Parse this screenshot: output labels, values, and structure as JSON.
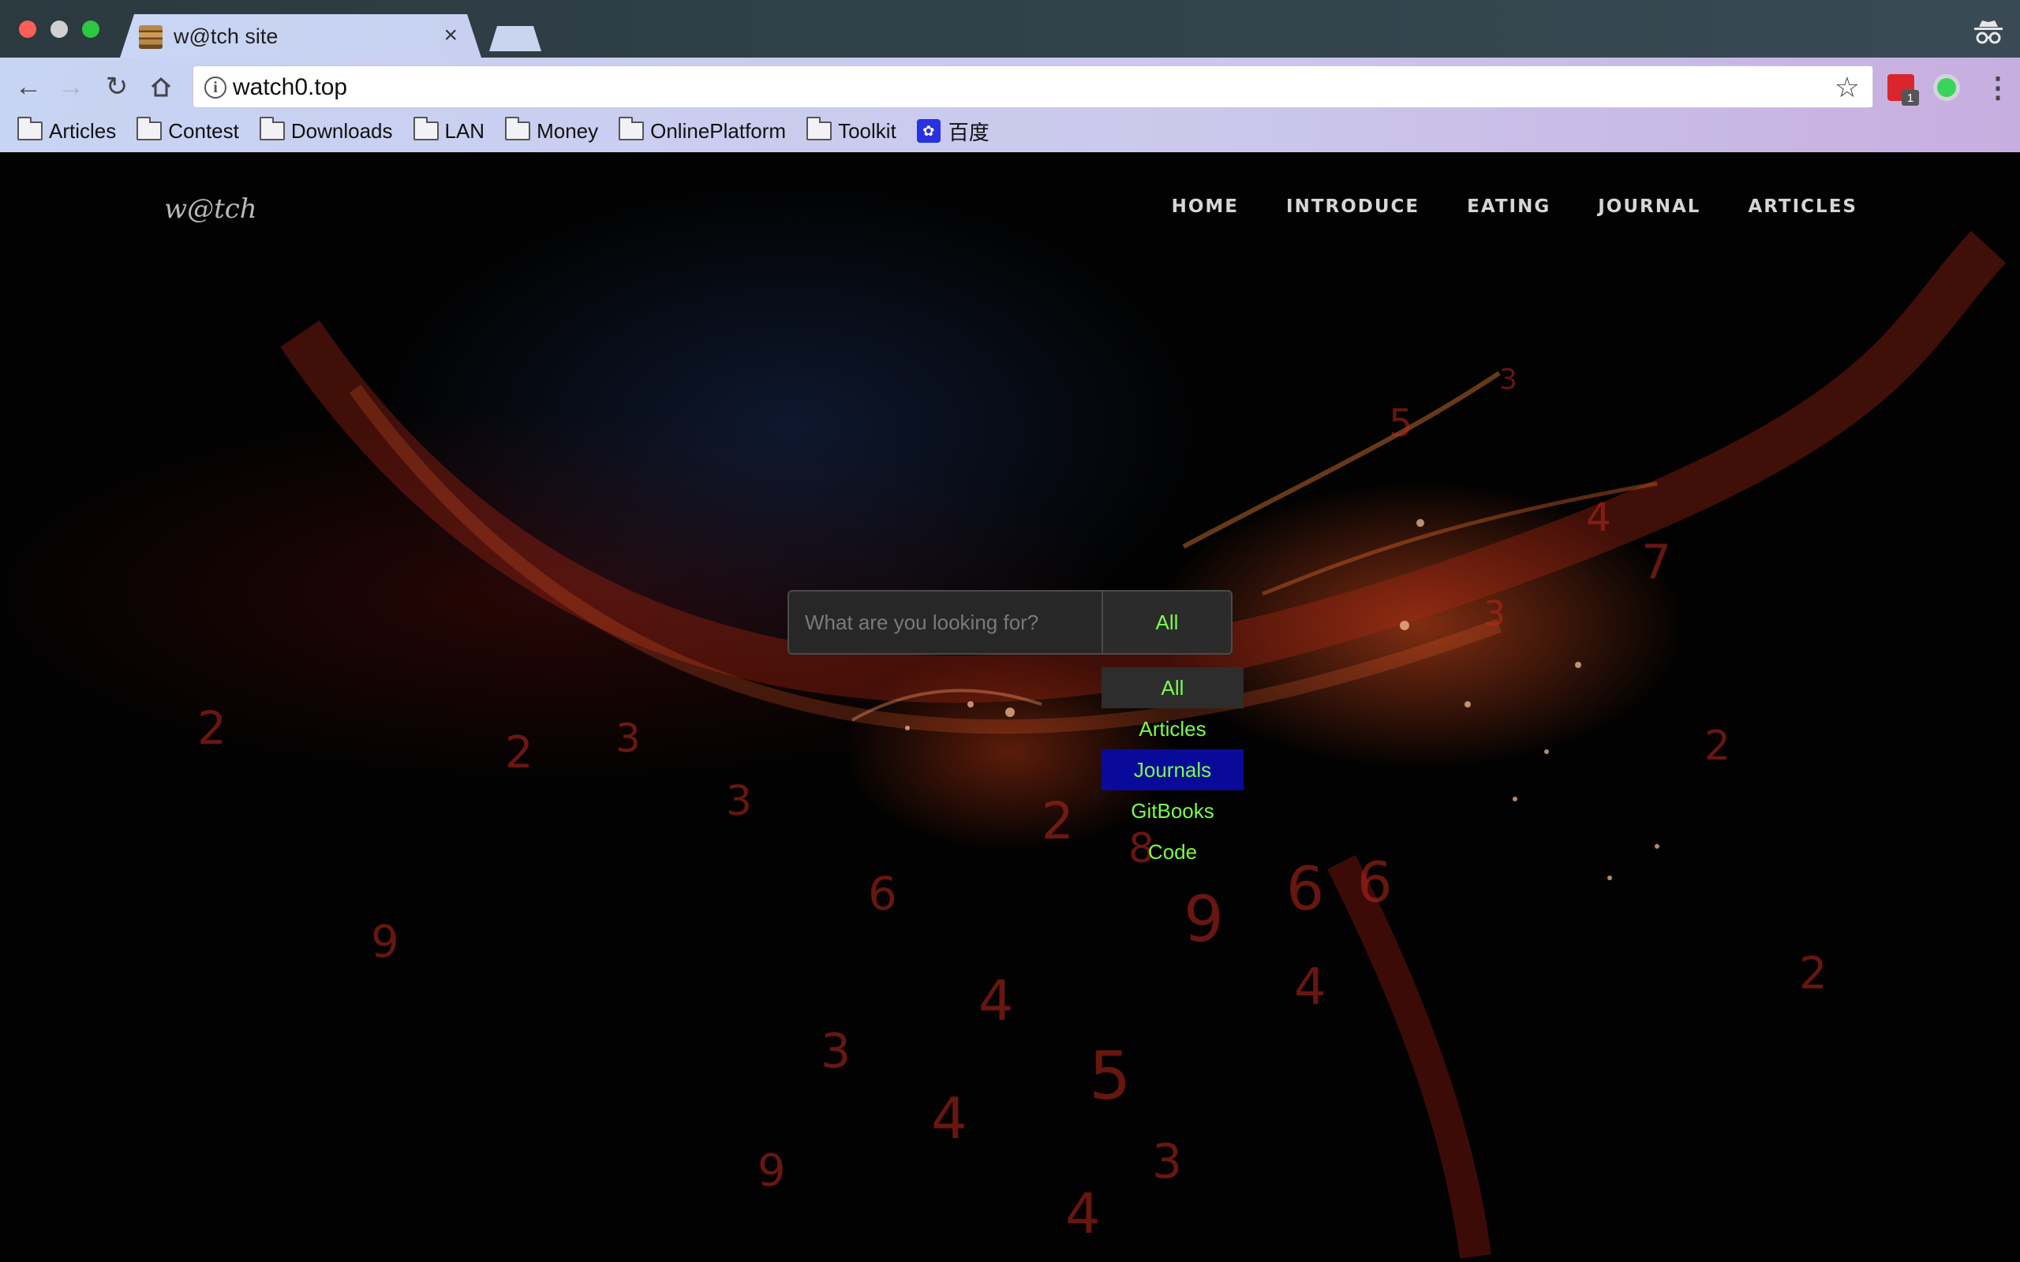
{
  "browser": {
    "tab_title": "w@tch site",
    "tab_close": "×",
    "url": "watch0.top",
    "extension_badge": "1",
    "bookmarks": [
      {
        "label": "Articles",
        "icon": "folder-icon"
      },
      {
        "label": "Contest",
        "icon": "folder-icon"
      },
      {
        "label": "Downloads",
        "icon": "folder-icon"
      },
      {
        "label": "LAN",
        "icon": "folder-icon"
      },
      {
        "label": "Money",
        "icon": "folder-icon"
      },
      {
        "label": "OnlinePlatform",
        "icon": "folder-icon"
      },
      {
        "label": "Toolkit",
        "icon": "folder-icon"
      },
      {
        "label": "百度",
        "icon": "baidu-icon"
      }
    ]
  },
  "site": {
    "logo": "w@tch",
    "nav": [
      "HOME",
      "INTRODUCE",
      "EATING",
      "JOURNAL",
      "ARTICLES"
    ],
    "search": {
      "placeholder": "What are you looking for?",
      "filter_value": "All",
      "options": [
        "All",
        "Articles",
        "Journals",
        "GitBooks",
        "Code"
      ],
      "selected_option": "All",
      "highlighted_option": "Journals"
    }
  },
  "colors": {
    "accent_green": "#7cfc4a",
    "highlight_blue": "#0a0a9a",
    "background": "#020202"
  }
}
